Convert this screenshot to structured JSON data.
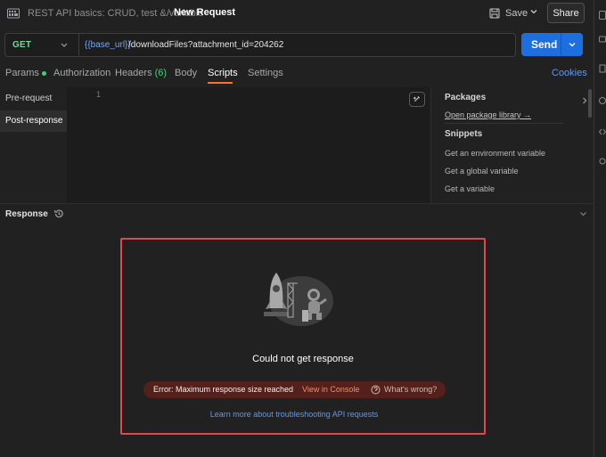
{
  "header": {
    "collection": "REST API basics: CRUD, test & variable",
    "separator": "/",
    "request_name": "New Request",
    "save_label": "Save",
    "share_label": "Share"
  },
  "urlbar": {
    "method": "GET",
    "url_variable": "{{base_url}}",
    "url_path": "/downloadFiles?attachment_id=204262",
    "send_label": "Send"
  },
  "tabs": {
    "items": [
      {
        "label": "Params"
      },
      {
        "label": "Authorization"
      },
      {
        "label": "Headers",
        "count": "(6)"
      },
      {
        "label": "Body"
      },
      {
        "label": "Scripts"
      },
      {
        "label": "Settings"
      }
    ],
    "active": "Scripts",
    "cookies_label": "Cookies"
  },
  "scripts": {
    "options": [
      "Pre-request",
      "Post-response"
    ],
    "active": "Post-response",
    "line_number": "1"
  },
  "side_panel": {
    "packages_title": "Packages",
    "open_library": "Open package library",
    "arrow": "→",
    "snippets_title": "Snippets",
    "snippets": [
      "Get an environment variable",
      "Get a global variable",
      "Get a variable"
    ]
  },
  "response": {
    "title": "Response",
    "message": "Could not get response",
    "error_text": "Error: Maximum response size reached",
    "view_console": "View in Console",
    "whats_wrong": "What's wrong?",
    "learn_more": "Learn more about troubleshooting API requests"
  },
  "colors": {
    "accent_orange": "#ff6c37",
    "send_blue": "#1d6fe0",
    "get_green": "#6bdd9a",
    "link_blue": "#5a9af5",
    "highlight_red": "#e2464f",
    "error_bg": "#53201b"
  },
  "icons": [
    "app-logo-icon",
    "save-icon",
    "chevron-down-icon",
    "ai-assist-icon",
    "chevron-right-icon",
    "history-icon",
    "rocket-astronaut-illustration",
    "help-icon"
  ]
}
